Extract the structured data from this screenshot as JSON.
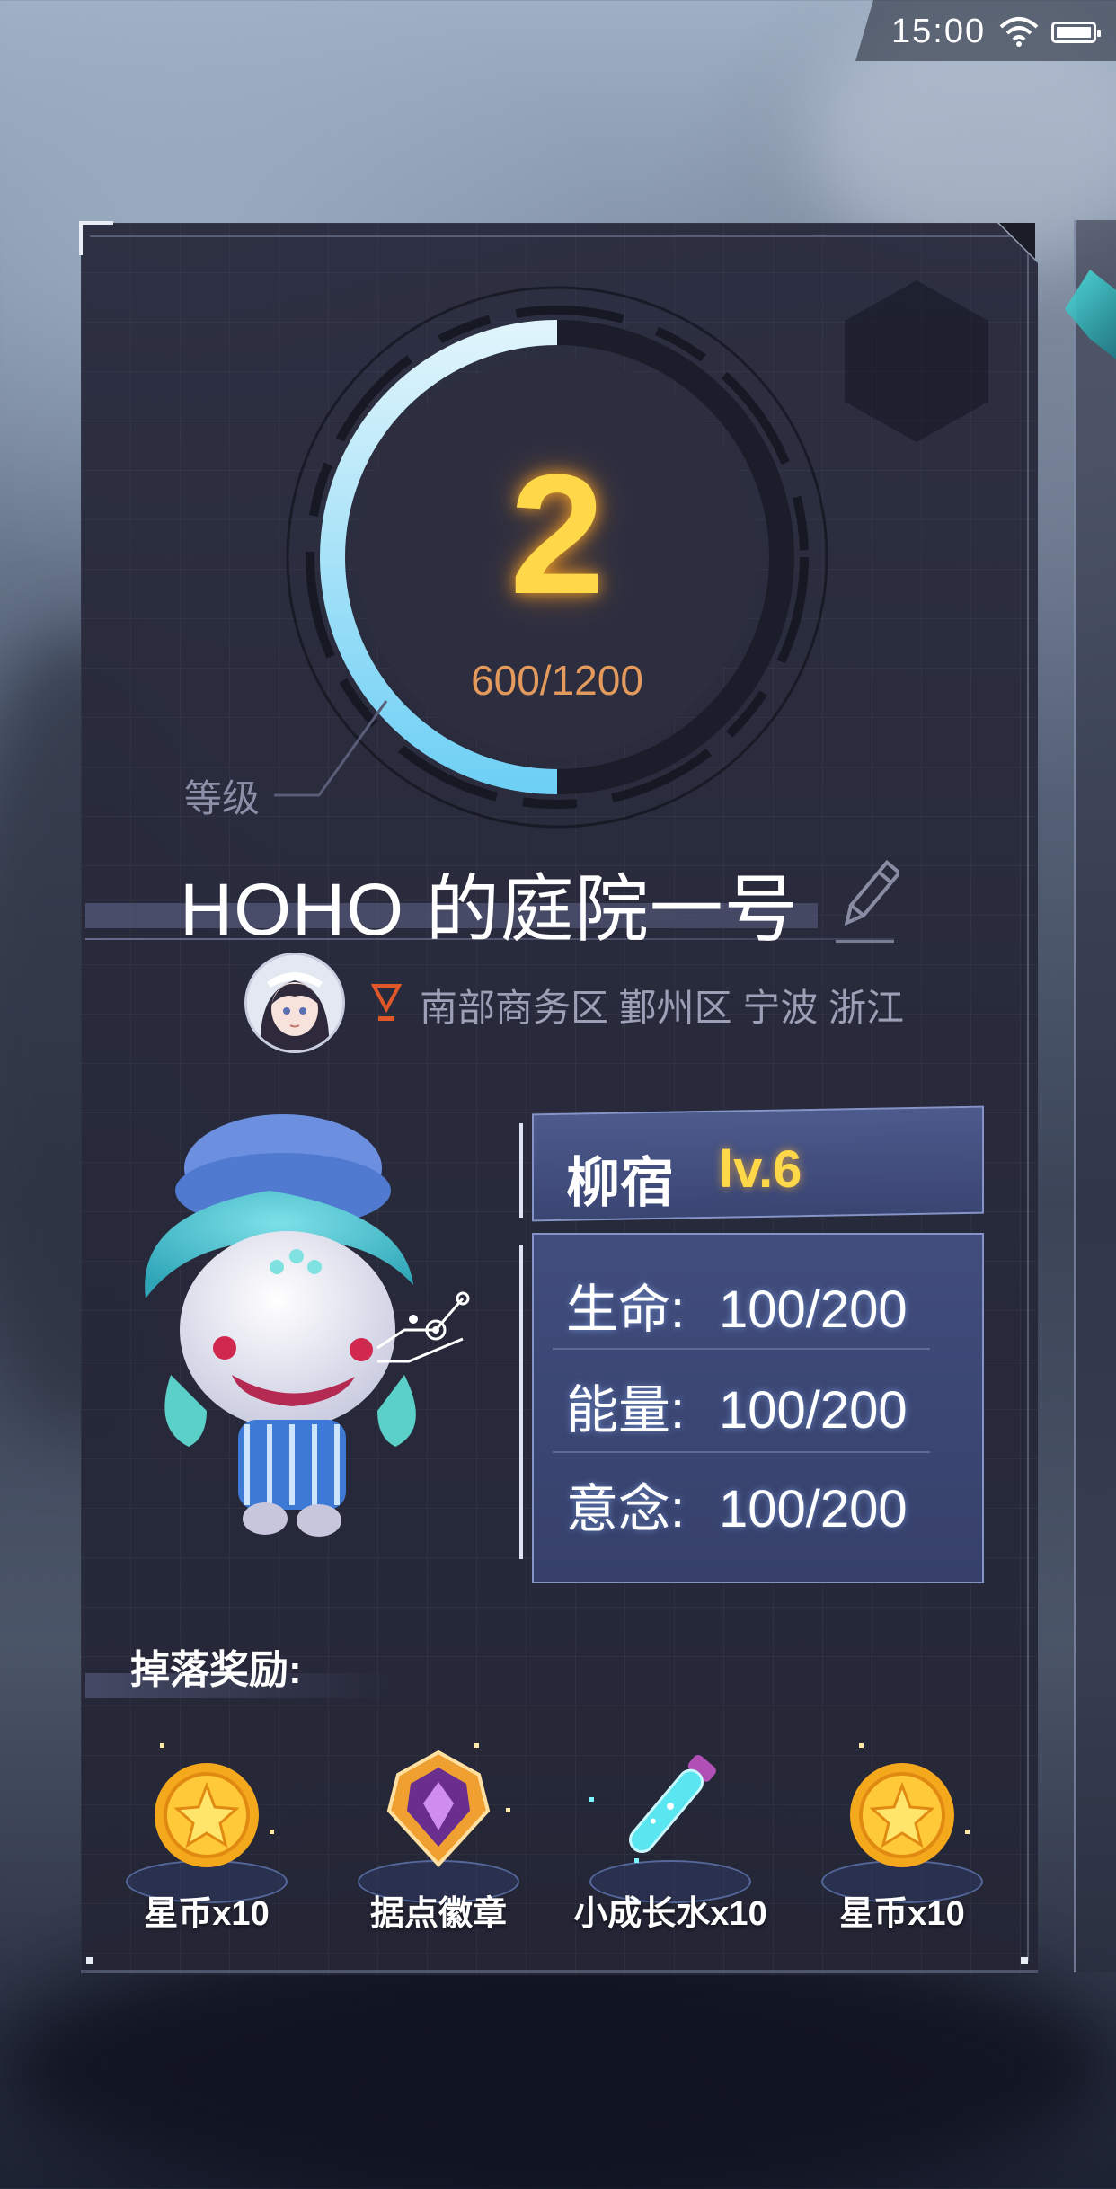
{
  "status_bar": {
    "time": "15:00",
    "wifi_icon": "wifi-icon",
    "battery_icon": "battery-icon"
  },
  "yard": {
    "level": "2",
    "exp_text": "600/1200",
    "exp_progress": 0.5,
    "level_label": "等级",
    "title": "HOHO 的庭院一号",
    "edit_icon": "pencil-icon",
    "location": "南部商务区 鄞州区 宁波 浙江",
    "location_icon": "location-pin-icon"
  },
  "monster": {
    "name": "柳宿",
    "level": "lv.6",
    "stats": [
      {
        "label": "生命:",
        "value": "100/200"
      },
      {
        "label": "能量:",
        "value": "100/200"
      },
      {
        "label": "意念:",
        "value": "100/200"
      }
    ]
  },
  "rewards": {
    "title": "掉落奖励:",
    "items": [
      {
        "label": "星币x10",
        "icon": "star-coin-icon"
      },
      {
        "label": "据点徽章",
        "icon": "badge-icon"
      },
      {
        "label": "小成长水x10",
        "icon": "potion-icon"
      },
      {
        "label": "星币x10",
        "icon": "star-coin-icon"
      }
    ]
  },
  "colors": {
    "level_gold": "#ffd84a",
    "exp_orange": "#e39a5c",
    "ring_cyan": "#7fd8f6",
    "panel_blue": "#414d7c"
  }
}
